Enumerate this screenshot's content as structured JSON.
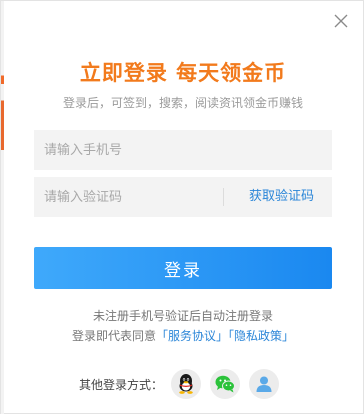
{
  "dialog": {
    "title": "立即登录 每天领金币",
    "subtitle": "登录后，可签到，搜索，阅读资讯领金币赚钱"
  },
  "form": {
    "phone_placeholder": "请输入手机号",
    "phone_value": "",
    "code_placeholder": "请输入验证码",
    "code_value": "",
    "get_code_label": "获取验证码",
    "login_label": "登录"
  },
  "footer": {
    "notice": "未注册手机号验证后自动注册登录",
    "agree_prefix": "登录即代表同意",
    "service_link": "「服务协议」",
    "privacy_link": "「隐私政策」",
    "other_label": "其他登录方式："
  },
  "social": [
    {
      "name": "qq-icon"
    },
    {
      "name": "wechat-icon"
    },
    {
      "name": "account-icon"
    }
  ],
  "colors": {
    "title": "#f27a1c",
    "link": "#2b86d8",
    "button_start": "#3fa9fb",
    "button_end": "#1a88f0"
  }
}
